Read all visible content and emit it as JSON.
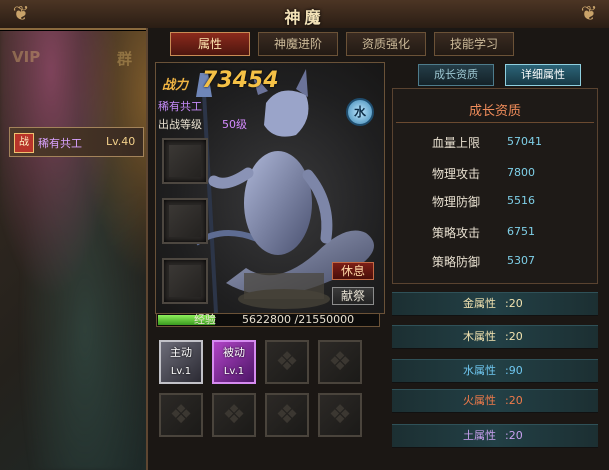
{
  "window": {
    "title": "神魔"
  },
  "background": {
    "faded_left": "VIP",
    "faded_mid": "群"
  },
  "sidebar": {
    "items": [
      {
        "badge": "战",
        "name": "稀有共工",
        "level": "Lv.40"
      }
    ]
  },
  "tabs": [
    {
      "label": "属性",
      "active": true
    },
    {
      "label": "神魔进阶",
      "active": false
    },
    {
      "label": "资质强化",
      "active": false
    },
    {
      "label": "技能学习",
      "active": false
    }
  ],
  "hero": {
    "power_label": "战力",
    "power_value": "73454",
    "rarity_name": "稀有共工",
    "level_label": "出战等级",
    "level_value": "50级",
    "element": "水",
    "rest_button": "休息",
    "sacrifice_button": "献祭"
  },
  "experience": {
    "label": "经验",
    "current": 5622800,
    "max": 21550000,
    "text": "5622800 /21550000"
  },
  "skills": {
    "active": {
      "label": "主动",
      "level": "Lv.1"
    },
    "passive": {
      "label": "被动",
      "level": "Lv.1"
    }
  },
  "right_tabs": {
    "growth": "成长资质",
    "detail": "详细属性"
  },
  "growth": {
    "title": "成长资质",
    "stats": [
      {
        "name": "血量上限",
        "value": "57041"
      },
      {
        "name": "物理攻击",
        "value": "7800"
      },
      {
        "name": "物理防御",
        "value": "5516"
      },
      {
        "name": "策略攻击",
        "value": "6751"
      },
      {
        "name": "策略防御",
        "value": "5307"
      }
    ]
  },
  "attributes": [
    {
      "name": "金属性",
      "value": ":20",
      "color": "#f2e3b0"
    },
    {
      "name": "木属性",
      "value": ":20",
      "color": "#f2e3b0"
    },
    {
      "name": "水属性",
      "value": ":90",
      "color": "#6fc7f0"
    },
    {
      "name": "火属性",
      "value": ":20",
      "color": "#f07a4a"
    },
    {
      "name": "土属性",
      "value": ":20",
      "color": "#c9a0f0"
    }
  ]
}
